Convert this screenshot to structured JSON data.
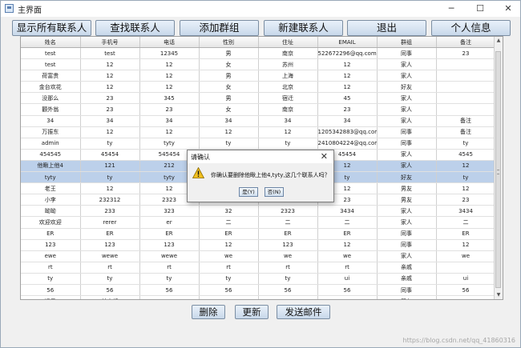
{
  "window": {
    "title": "主界面",
    "minimize": "─",
    "maximize": "☐",
    "close": "✕"
  },
  "toolbar": {
    "buttons": [
      "显示所有联系人",
      "查找联系人",
      "添加群组",
      "新建联系人",
      "退出",
      "个人信息"
    ]
  },
  "table": {
    "columns": [
      "姓名",
      "手机号",
      "电话",
      "性别",
      "住址",
      "EMAIL",
      "群组",
      "备注"
    ],
    "rows": [
      [
        "test",
        "test",
        "12345",
        "男",
        "南京",
        "522672296@qq.com",
        "同事",
        "23"
      ],
      [
        "test",
        "12",
        "12",
        "女",
        "苏州",
        "12",
        "家人",
        ""
      ],
      [
        "荷富贵",
        "12",
        "12",
        "男",
        "上海",
        "12",
        "家人",
        ""
      ],
      [
        "金台欢花",
        "12",
        "12",
        "女",
        "北京",
        "12",
        "好友",
        ""
      ],
      [
        "没那么",
        "23",
        "345",
        "男",
        "宿迁",
        "45",
        "家人",
        ""
      ],
      [
        "颧外翁",
        "23",
        "23",
        "女",
        "南京",
        "23",
        "家人",
        ""
      ],
      [
        "34",
        "34",
        "34",
        "34",
        "34",
        "34",
        "家人",
        "备注"
      ],
      [
        "万振东",
        "12",
        "12",
        "12",
        "12",
        "1205342883@qq.com",
        "同事",
        "备注"
      ],
      [
        "admin",
        "ty",
        "tyty",
        "ty",
        "ty",
        "2410804224@qq.com",
        "同事",
        "ty"
      ],
      [
        "454545",
        "45454",
        "545454",
        "",
        "",
        "45454",
        "家人",
        "4545"
      ],
      [
        "他瞅上他4",
        "121",
        "212",
        "",
        "",
        "12",
        "家人",
        "12"
      ],
      [
        "tyty",
        "ty",
        "tyty",
        "",
        "",
        "ty",
        "好友",
        "ty"
      ],
      [
        "老王",
        "12",
        "12",
        "",
        "",
        "12",
        "男友",
        "12"
      ],
      [
        "小李",
        "232312",
        "2323",
        "",
        "",
        "23",
        "男友",
        "23"
      ],
      [
        "呦呦",
        "233",
        "323",
        "32",
        "2323",
        "3434",
        "家人",
        "3434"
      ],
      [
        "欢迎欢迎",
        "rerer",
        "er",
        "二",
        "二",
        "二",
        "家人",
        "二"
      ],
      [
        "ER",
        "ER",
        "ER",
        "ER",
        "ER",
        "ER",
        "同事",
        "ER"
      ],
      [
        "123",
        "123",
        "123",
        "12",
        "123",
        "12",
        "同事",
        "12"
      ],
      [
        "ewe",
        "wewe",
        "wewe",
        "we",
        "we",
        "we",
        "家人",
        "we"
      ],
      [
        "rt",
        "rt",
        "rt",
        "rt",
        "rt",
        "rt",
        "亲戚",
        ""
      ],
      [
        "ty",
        "ty",
        "ty",
        "ty",
        "ty",
        "ui",
        "亲戚",
        "ui"
      ],
      [
        "56",
        "56",
        "56",
        "56",
        "56",
        "56",
        "同事",
        "56"
      ],
      [
        "迁子",
        "韩大叔",
        "",
        "",
        "",
        "",
        "基友",
        ""
      ]
    ],
    "selected_rows": [
      10,
      11
    ]
  },
  "scrollbar": {
    "up": "▲",
    "down": "▼"
  },
  "bottom_buttons": [
    "删除",
    "更新",
    "发送邮件"
  ],
  "dialog": {
    "title": "请确认",
    "close": "✕",
    "message": "你确认要删除他瞅上他4,tyty,这几个联系人吗？",
    "yes": "是(Y)",
    "no": "否(N)"
  },
  "colors": {
    "selected_row": "#bcd0ea",
    "button_top": "#e9f1fa",
    "button_bottom": "#c8d8ea",
    "warning": "#f2c01e"
  },
  "watermark": "https://blog.csdn.net/qq_41860316"
}
